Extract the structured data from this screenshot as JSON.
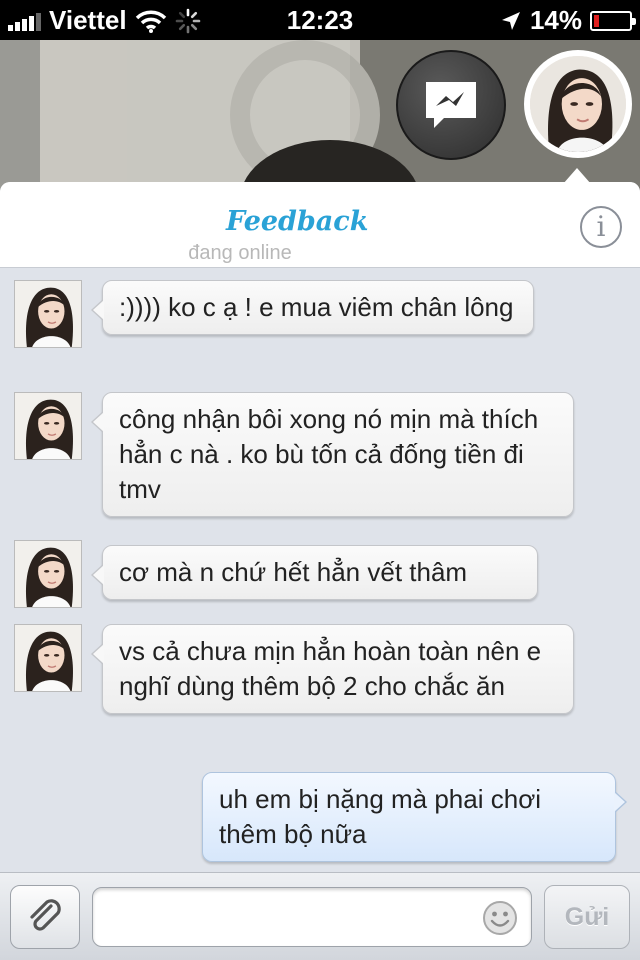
{
  "status_bar": {
    "carrier": "Viettel",
    "time": "12:23",
    "battery": "14%",
    "battery_level": 0.14,
    "signal_icon": "signal-bars-icon",
    "wifi_icon": "wifi-icon",
    "activity_icon": "spinner-icon",
    "location_icon": "location-arrow-icon"
  },
  "chat_heads": {
    "messenger_icon": "messenger-bolt-icon",
    "user_avatar": "user-avatar"
  },
  "header": {
    "title": "Feedback",
    "subtitle": "đang online",
    "info_icon": "info-icon",
    "info_label": "i"
  },
  "messages": [
    {
      "direction": "in",
      "text": ":)))) ko c ạ ! e mua viêm chân lông"
    },
    {
      "direction": "in",
      "text": "công nhận bôi xong nó mịn mà thích hẳn c nà . ko bù tốn cả đống tiền đi tmv"
    },
    {
      "direction": "in",
      "text": "cơ mà n chứ hết hẳn vết thâm"
    },
    {
      "direction": "in",
      "text": "vs cả chưa mịn hẳn hoàn toàn nên e nghĩ dùng thêm bộ 2 cho chắc ăn"
    },
    {
      "direction": "out",
      "text": "uh em bị nặng mà phai chơi thêm bộ nữa"
    }
  ],
  "composer": {
    "attach_icon": "paperclip-icon",
    "input_value": "",
    "emoji_icon": "smiley-icon",
    "send_label": "Gửi"
  },
  "colors": {
    "title": "#2aa2d6",
    "chat_background": "#dfe3ea",
    "outgoing_bubble": "#d7e7fb",
    "battery_low": "#e02020"
  }
}
